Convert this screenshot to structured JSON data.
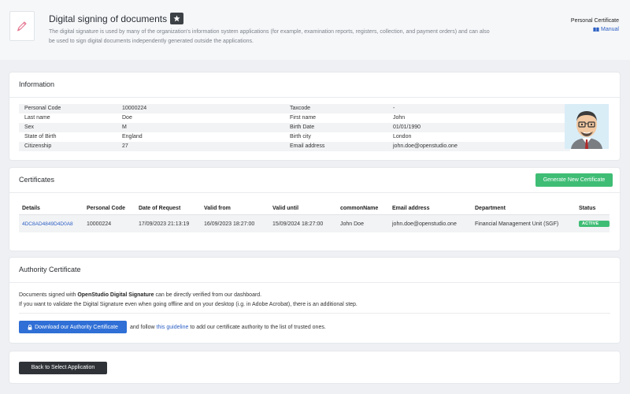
{
  "header": {
    "title": "Digital signing of documents",
    "description": "The digital signature is used by many of the organization's information system applications (for example, examination reports, registers, collection, and payment orders) and can also be used to sign digital documents independently generated outside the applications.",
    "personal_certificate": "Personal Certificate",
    "manual": "Manual",
    "icons": {
      "logo": "pen-icon",
      "badge": "star-icon",
      "manual": "book-icon"
    }
  },
  "information": {
    "title": "Information",
    "rows": [
      {
        "l1": "Personal Code",
        "v1": "10000224",
        "l2": "Taxcode",
        "v2": "-"
      },
      {
        "l1": "Last name",
        "v1": "Doe",
        "l2": "First name",
        "v2": "John"
      },
      {
        "l1": "Sex",
        "v1": "M",
        "l2": "Birth Date",
        "v2": "01/01/1990"
      },
      {
        "l1": "State of Birth",
        "v1": "England",
        "l2": "Birth city",
        "v2": "London"
      },
      {
        "l1": "Citizenship",
        "v1": "27",
        "l2": "Email address",
        "v2": "john.doe@openstudio.one"
      }
    ]
  },
  "certificates": {
    "title": "Certificates",
    "generate_button": "Generate New Certificate",
    "columns": [
      "Details",
      "Personal Code",
      "Date of Request",
      "Valid from",
      "Valid until",
      "commonName",
      "Email address",
      "Department",
      "Status"
    ],
    "rows": [
      {
        "details": "4DC8AD4849D4D0A8",
        "personal_code": "10000224",
        "date_of_request": "17/09/2023 21:13:19",
        "valid_from": "16/09/2023 18:27:00",
        "valid_until": "15/09/2024 18:27:00",
        "common_name": "John Doe",
        "email": "john.doe@openstudio.one",
        "department": "Financial Management Unit (SGF)",
        "status": "ACTIVE"
      }
    ],
    "colors": {
      "generate": "#3fbd75",
      "active": "#3fbd75"
    }
  },
  "authority": {
    "title": "Authority Certificate",
    "line1_pre": "Documents signed with ",
    "line1_bold": "OpenStudio Digital Signature",
    "line1_post": " can be directly verified from our dashboard.",
    "line2": "If you want to validate the Digital Signature even when going offline and on your desktop (i.g. in Adobe Acrobat), there is an additional step.",
    "download_button": "Download our Authority Certificate",
    "follow_pre": "and follow",
    "guideline_link": "this guideline",
    "follow_post": "to add our certificate authority to the list of trusted ones."
  },
  "footer": {
    "back_button": "Back to Select Application"
  }
}
